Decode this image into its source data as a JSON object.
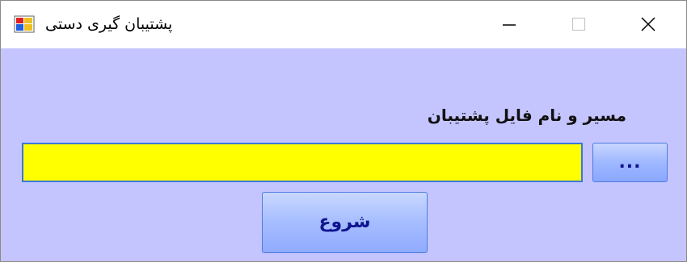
{
  "window": {
    "title": "پشتیبان گیری دستی"
  },
  "form": {
    "field_label": "مسیر و نام فایل پشتیبان",
    "path_value": "",
    "browse_label": "...",
    "start_label": "شروع"
  },
  "colors": {
    "client_background": "#c4c4ff",
    "input_background": "#ffff00",
    "button_text": "#10148f"
  }
}
